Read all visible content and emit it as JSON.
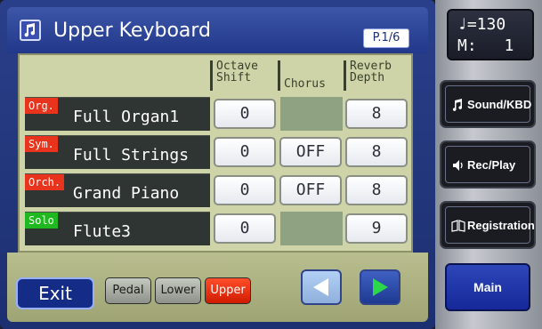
{
  "header": {
    "title": "Upper Keyboard",
    "page": "P.1/6"
  },
  "columns": {
    "octave_shift": [
      "Octave",
      "Shift"
    ],
    "chorus": "Chorus",
    "reverb_depth": [
      "Reverb",
      "Depth"
    ]
  },
  "rows": [
    {
      "category": "Org.",
      "category_color": "#e8341c",
      "name": "Full Organ1",
      "octave_shift": "0",
      "chorus": "",
      "reverb_depth": "8"
    },
    {
      "category": "Sym.",
      "category_color": "#e8341c",
      "name": "Full Strings",
      "octave_shift": "0",
      "chorus": "OFF",
      "reverb_depth": "8"
    },
    {
      "category": "Orch.",
      "category_color": "#e8341c",
      "name": "Grand Piano",
      "octave_shift": "0",
      "chorus": "OFF",
      "reverb_depth": "8"
    },
    {
      "category": "Solo",
      "category_color": "#1fb81f",
      "name": "Flute3",
      "octave_shift": "0",
      "chorus": "",
      "reverb_depth": "9"
    }
  ],
  "footer": {
    "exit_label": "Exit",
    "parts": [
      {
        "label": "Pedal",
        "selected": false
      },
      {
        "label": "Lower",
        "selected": false
      },
      {
        "label": "Upper",
        "selected": true
      }
    ],
    "prev_icon": "arrow-left-icon",
    "next_icon": "arrow-right-icon"
  },
  "status": {
    "tempo_symbol": "♩",
    "tempo_value": "=130",
    "measure_label": "M:",
    "measure_value": "1"
  },
  "side_buttons": [
    {
      "label": "Sound/KBD",
      "icon": "music-note-icon"
    },
    {
      "label": "Rec/Play",
      "icon": "speaker-icon"
    },
    {
      "label": "Registration",
      "icon": "book-icon"
    }
  ],
  "main_label": "Main",
  "colors": {
    "display_blue": "#22388a",
    "panel_olive": "#cfd4a8",
    "selected_part": "#e8341c",
    "solo_green": "#1fb81f"
  }
}
